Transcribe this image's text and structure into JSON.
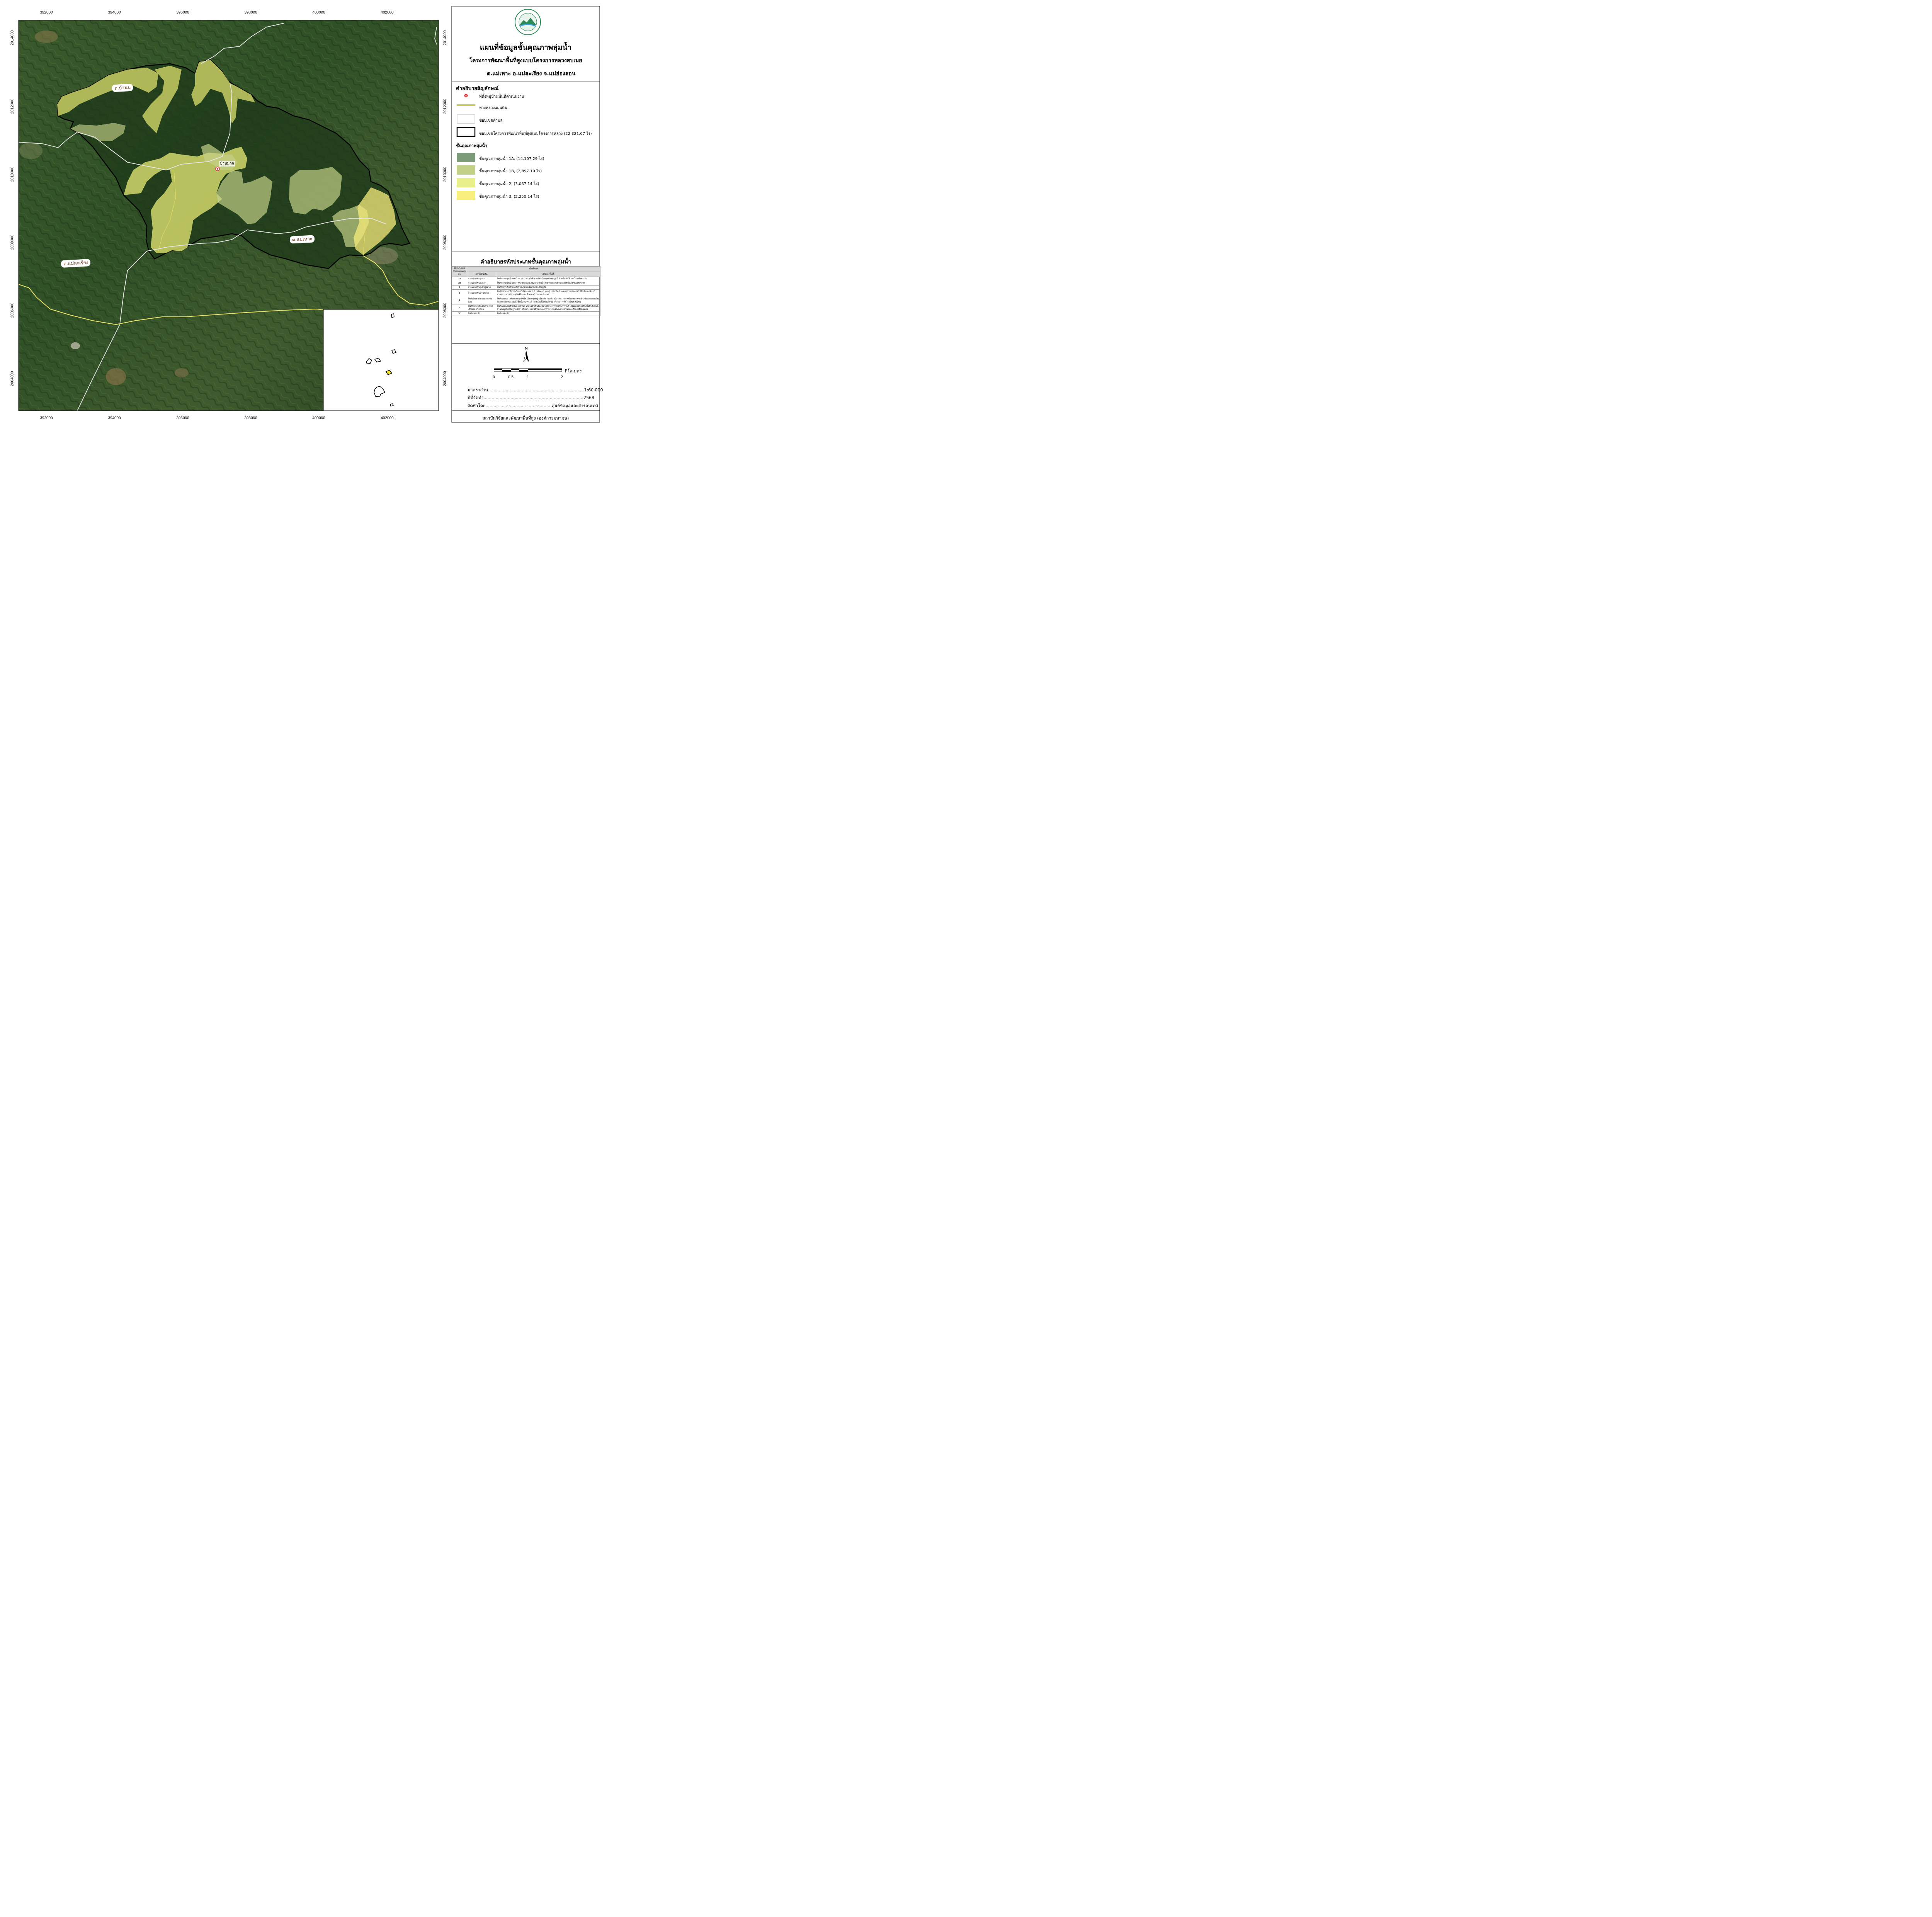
{
  "title": {
    "main": "แผนที่ข้อมูลชั้นคุณภาพลุ่มน้ำ",
    "sub": "โครงการพัฒนาพื้นที่สูงแบบโครงการหลวงสบเมย",
    "location": "ต.แม่เหาะ อ.แม่สะเรียง จ.แม่ฮ่องสอน"
  },
  "logo": {
    "icon": "institute-logo-icon",
    "ring_text": "สถาบันวิจัยและพัฒนาพื้นที่สูง (องค์การมหาชน)"
  },
  "axes": {
    "x_ticks": [
      "392000",
      "394000",
      "396000",
      "398000",
      "400000",
      "402000"
    ],
    "y_ticks": [
      "2014000",
      "2012000",
      "2010000",
      "2008000",
      "2006000",
      "2004000"
    ]
  },
  "map_labels": {
    "village": "ป่าหมาก",
    "tambon_banpae": "ต.บ้านป",
    "tambon_maehoh": "ต.แม่เหาะ",
    "tambon_maesariang": "ต.แม่สะเรียง"
  },
  "legend": {
    "heading": "คำอธิบายสัญลักษณ์",
    "items": [
      {
        "label": "ที่ตั้งหมู่บ้านพื้นที่ดำเนินงาน",
        "icon": "village-marker-icon",
        "color": "#e0303a"
      },
      {
        "label": "ทางหลวงแผ่นดิน",
        "icon": "highway-line-icon",
        "color": "#c8c84a"
      },
      {
        "label": "ขอบเขตตำบล",
        "icon": "subdistrict-boundary-icon",
        "color": "#d9d9d9"
      },
      {
        "label": "ขอบเขตโครงการพัฒนาพื้นที่สูงแบบโครงการหลวง (22,321.67 ไร่)",
        "icon": "project-boundary-icon",
        "color": "#000000"
      }
    ],
    "subheading": "ชั้นคุณภาพลุ่มน้ำ",
    "classes": [
      {
        "label": "ชั้นคุณภาพลุ่มน้ำ   1A, (14,107.29 ไร่)",
        "color": "#7a9a78"
      },
      {
        "label": "ชั้นคุณภาพลุ่มน้ำ   1B, (2,897.10 ไร่)",
        "color": "#c3d087"
      },
      {
        "label": "ชั้นคุณภาพลุ่มน้ำ   2, (3,067.14 ไร่)",
        "color": "#e8ee8a"
      },
      {
        "label": "ชั้นคุณภาพลุ่มน้ำ   3, (2,250.14 ไร่)",
        "color": "#f7ee7c"
      }
    ]
  },
  "code_table": {
    "heading": "คำอธิบายรหัสประเภทชั้นคุณภาพลุ่มน้ำ",
    "headers": {
      "code": "รหัสประเภทชั้นคุณภาพลุ่มน้ำ",
      "desc": "คำอธิบาย",
      "slope": "ความลาดชัน",
      "character": "ลักษณะพื้นที่"
    },
    "rows": [
      {
        "code": "1A",
        "slope": "ความลาดชันสูงมาก",
        "character": "พื้นที่ป่าสมบูรณ์ ก่อนปี 2525 ป่าต้นน้ำลำธารที่ยังมีสภาพป่าสมบูรณ์ ห้ามมีการใช้ ประโยชน์อย่างอื่น"
      },
      {
        "code": "1B",
        "slope": "ความลาดชันสูงมาก",
        "character": "พื้นที่ป่าสมบูรณ์ แต่มีการบุกรุกก่อนปี 2525 ป่าต้นน้ำลำธารและควบคุมการใช้ประโยชน์เป็นพิเศษ"
      },
      {
        "code": "2",
        "slope": "ความลาดชันสูงถึงสูงมาก",
        "character": "พื้นที่ที่ควรเก็บรักษาไว้ใช้ประโยชน์เพื่อเป็นป่าเศรษฐกิจ"
      },
      {
        "code": "3",
        "slope": "ความลาดชันปานกลาง",
        "character": "พื้นที่ที่สามารถใช้ประโยชน์ได้ทั้งการทำไม้ เหมืองแร่ ทุ่งหญ้าเลี้ยงสัตว์เกษตรกรรม ประเภทไม้ยืนต้น แต่ต้องมีมาตรการทางด้านอนุรักษ์ดินและน้ำควบคู่ไปอย่างเข้มงวด"
      },
      {
        "code": "4",
        "slope": "พื้นที่เนินราบ ความลาดชันน้อย",
        "character": "พื้นที่เหมาะสำหรับการปลูกพืชไร่ ไม้ผล ทุ่งหญ้าเลี้ยงสัตว์ แต่ต้องมีมาตรการการป้องกันการชะล้างพังทลายของดิน โดยสภาพป่าของลุ่มน้ำชั้นนี้ถูกบุกรุกแผ้วถางเป็นที่ใช้ประโยชน์ เพื่อกิจการพืชไร่ เป็นส่วนใหญ่"
      },
      {
        "code": "5",
        "slope": "พื้นที่ที่ราบหรือเนินลาดเอียงเล็กน้อย หรือที่ลุ่ม",
        "character": "พื้นที่เหมาะสมสำหรับการทำนา โดยไม่จำเป็นต้องมีมาตรการการป้องกันการชะล้างพังทลายของดิน พื้นที่บริเวณนี้ส่วนใหญ่ป่าไม้ได้ถูกแผ้วถางเพื่อประโยชน์ด้านเกษตรกรรม โดยเฉพาะการทำนาและกิจการอื่นไปแล้ว"
      },
      {
        "code": "W",
        "slope": "พื้นที่แหล่งน้ำ",
        "character": "พื้นที่แหล่งน้ำ"
      }
    ]
  },
  "scale": {
    "unit": "กิโลเมตร",
    "ticks": [
      "0",
      "0.5",
      "1",
      "2"
    ],
    "ratio_label": "มาตราส่วน",
    "ratio": "1:60,000",
    "year_label": "ปีที่จัดทำ",
    "year": "2568",
    "made_by_label": "จัดทำโดย",
    "made_by": "ศูนย์ข้อมูลและสารสนเทศ",
    "north": "N"
  },
  "footer": "สถาบันวิจัยและพัฒนาพื้นที่สูง (องค์การมหาชน)"
}
